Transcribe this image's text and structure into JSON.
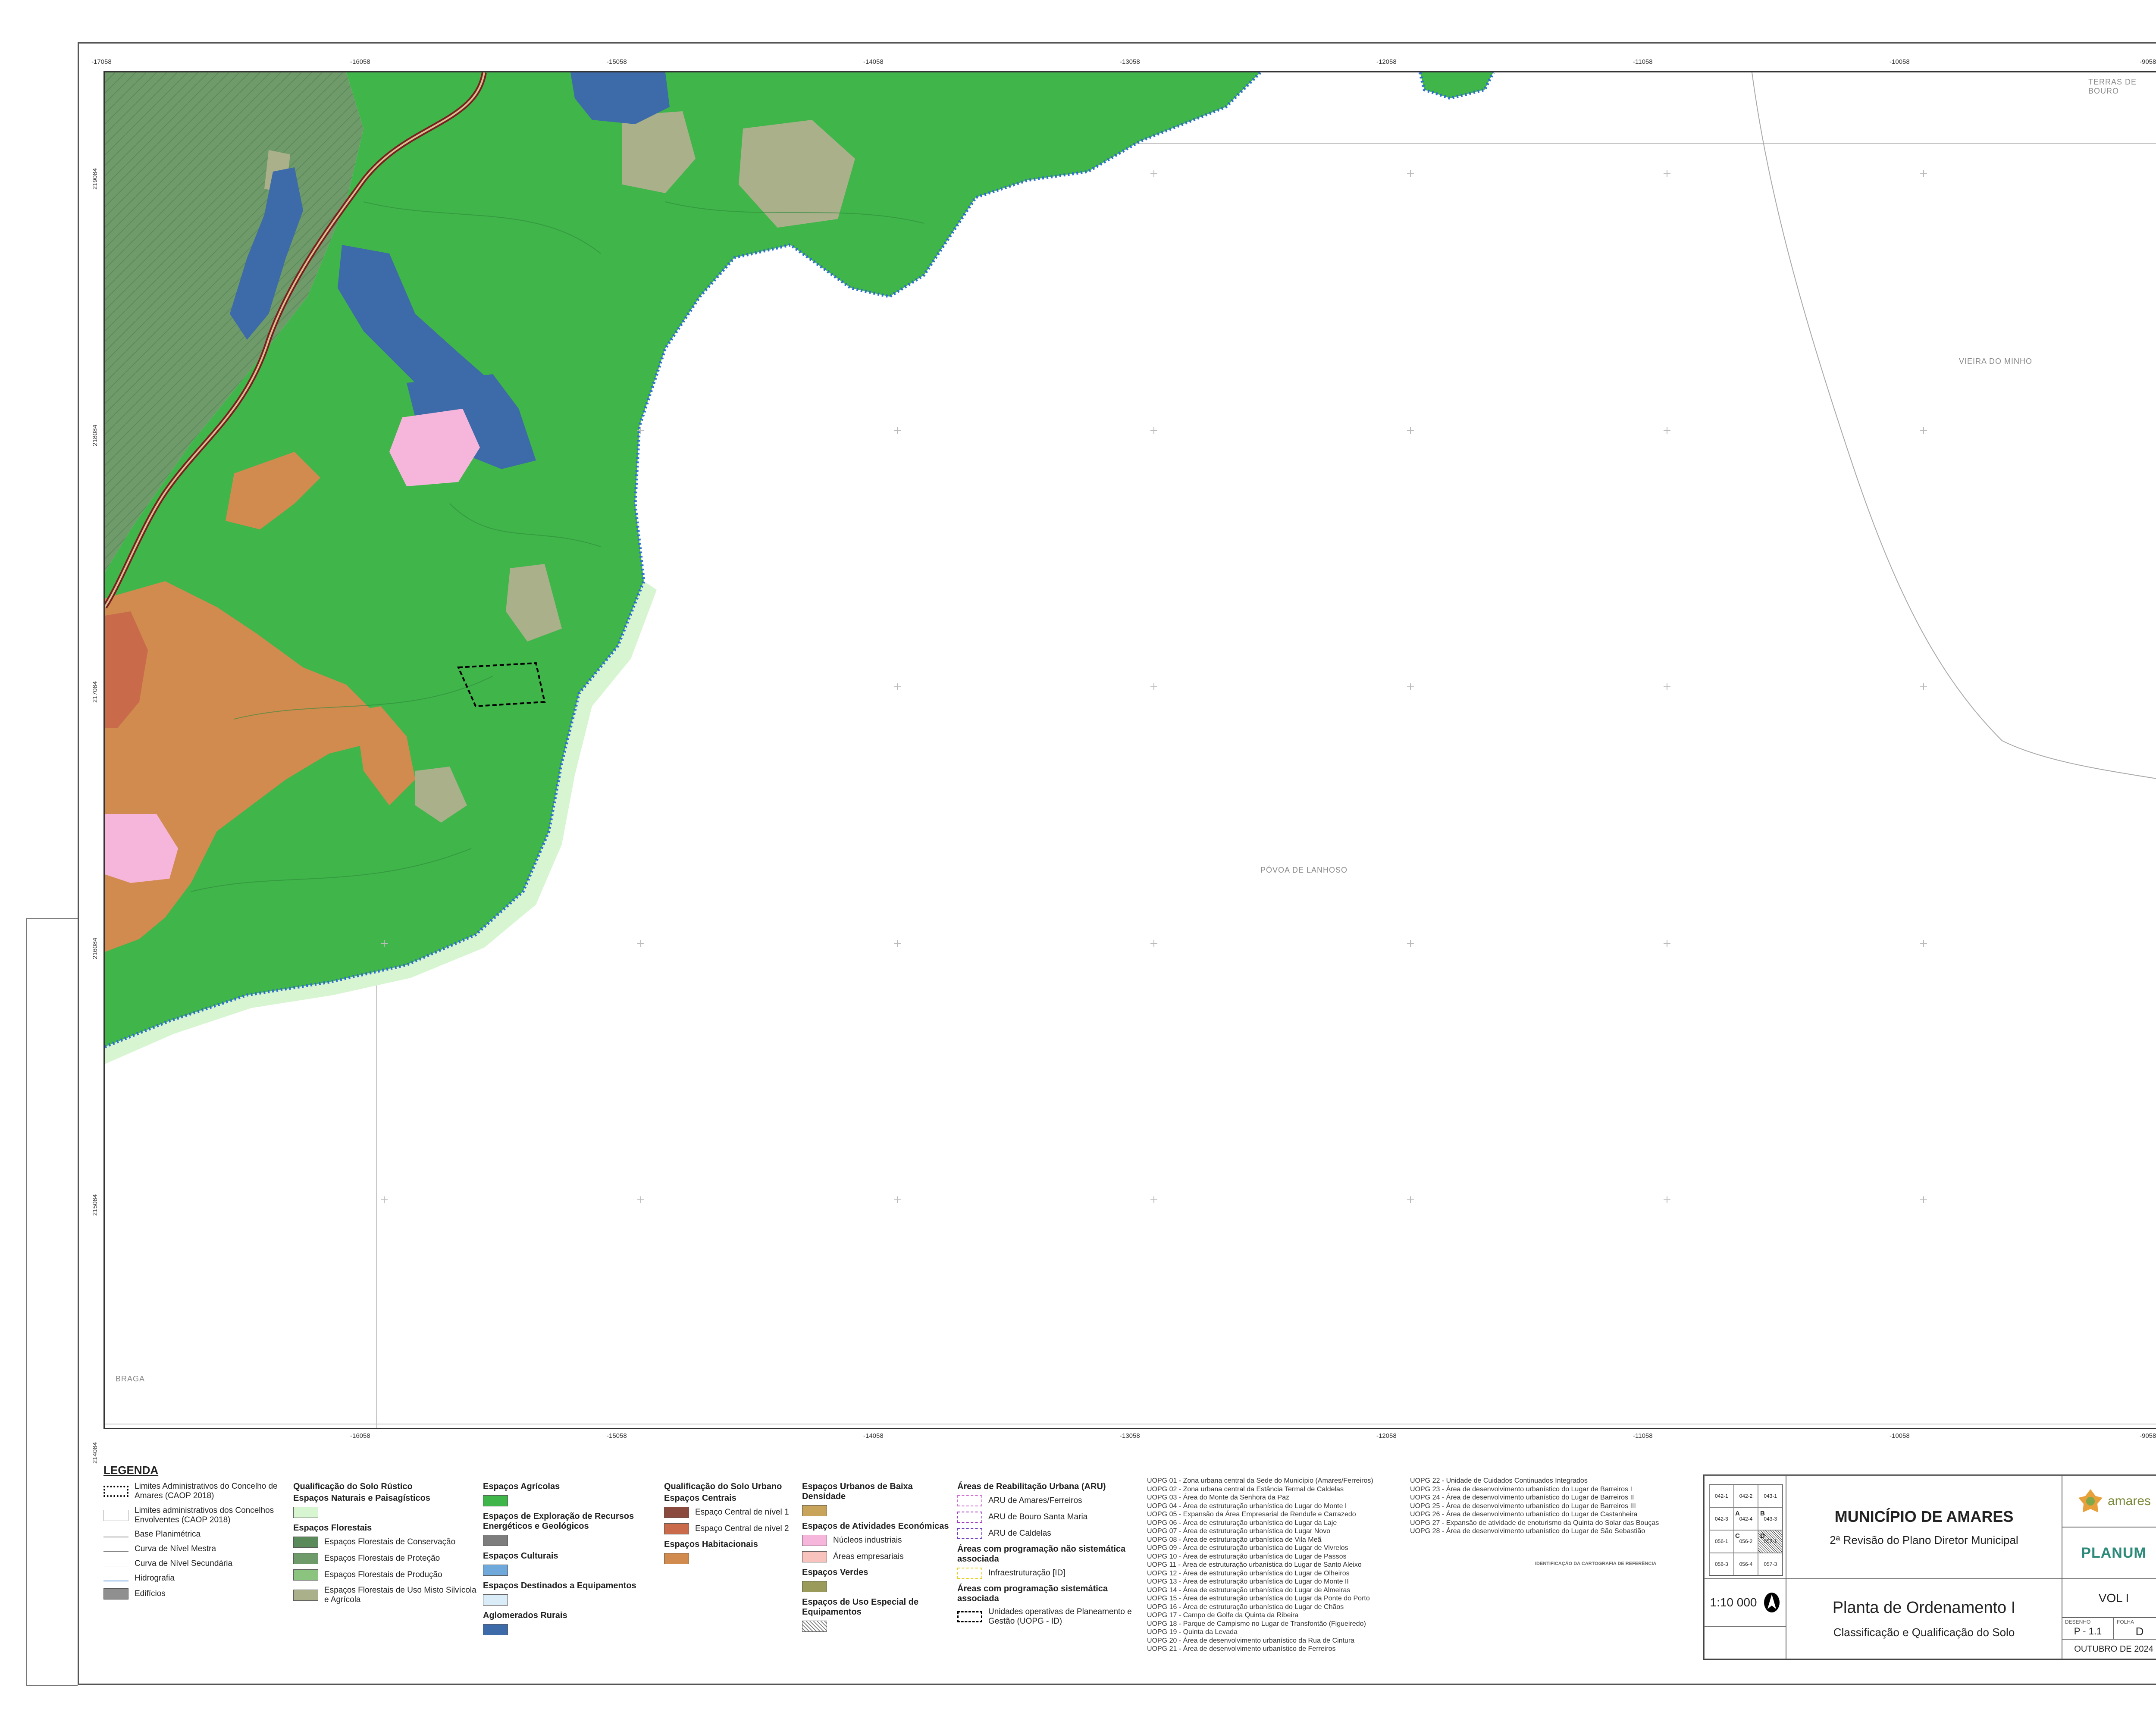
{
  "top_ticks": [
    "-17058",
    "-16058",
    "-15058",
    "-14058",
    "-13058",
    "-12058",
    "-11058",
    "-10058",
    "-9058"
  ],
  "side_ticks": [
    "219084",
    "218084",
    "217084",
    "216084",
    "215084",
    "214084"
  ],
  "place_labels": {
    "terras_bouro": "TERRAS DE BOURO",
    "vieira_minho": "VIEIRA DO MINHO",
    "povoa_lanhoso": "PÓVOA DE LANHOSO",
    "braga": "BRAGA"
  },
  "sheet_labels": {
    "s0564": "056-4",
    "s0573": "057-3"
  },
  "legend": {
    "title": "LEGENDA",
    "admin": [
      {
        "label": "Limites Administrativos do Concelho de Amares (CAOP 2018)",
        "style": "dotted"
      },
      {
        "label": "Limites administrativos dos Concelhos Envolventes (CAOP 2018)",
        "style": "thin"
      },
      {
        "label": "Base Planimétrica",
        "style": "line"
      },
      {
        "label": "Curva de Nível Mestra",
        "style": "line"
      },
      {
        "label": "Curva de Nível Secundária",
        "style": "line"
      },
      {
        "label": "Hidrografia",
        "style": "line"
      },
      {
        "label": "Edifícios",
        "color": "#8f8f8f"
      }
    ],
    "rustico_title": "Qualificação do Solo Rústico",
    "naturais_title": "Espaços Naturais e Paisagísticos",
    "naturais_color": "#d6f5d0",
    "florestais_title": "Espaços Florestais",
    "florestais": [
      {
        "label": "Espaços Florestais de Conservação",
        "color": "#5a8a5a"
      },
      {
        "label": "Espaços Florestais de Proteção",
        "color": "#6f9a6a"
      },
      {
        "label": "Espaços Florestais de Produção",
        "color": "#8ac47e"
      },
      {
        "label": "Espaços Florestais de Uso Misto Silvícola e Agrícola",
        "color": "#a9b08a"
      }
    ],
    "agricolas_title": "Espaços Agrícolas",
    "agricolas_color": "#3fb54a",
    "exploracao_title": "Espaços de Exploração de Recursos Energéticos e Geológicos",
    "exploracao_color": "#7d7d7d",
    "culturais_title": "Espaços Culturais",
    "culturais_color": "#6fa9dc",
    "equip_title": "Espaços Destinados a Equipamentos",
    "equip_color": "#d9ecf7",
    "aglom_title": "Aglomerados Rurais",
    "aglom_color": "#3d6aa8",
    "urbano_title": "Qualificação do Solo Urbano",
    "centrais_title": "Espaços Centrais",
    "centrais": [
      {
        "label": "Espaço Central de nível 1",
        "color": "#8b4a3e"
      },
      {
        "label": "Espaço Central de nível 2",
        "color": "#c96b4b"
      }
    ],
    "habit_title": "Espaços Habitacionais",
    "habit_color": "#d18b4f",
    "baixa_title": "Espaços Urbanos de Baixa Densidade",
    "baixa_color": "#c8a45a",
    "ativ_title": "Espaços de Atividades Económicas",
    "ativ": [
      {
        "label": "Núcleos industriais",
        "color": "#f6b6dc"
      },
      {
        "label": "Áreas empresariais",
        "color": "#f8c3bd"
      }
    ],
    "verdes_title": "Espaços Verdes",
    "verdes_color": "#9a9a5a",
    "especial_title": "Espaços de Uso Especial de Equipamentos",
    "aru_title": "Áreas de Reabilitação Urbana (ARU)",
    "aru": [
      {
        "label": "ARU de Amares/Ferreiros",
        "color": "#d070d0"
      },
      {
        "label": "ARU de Bouro Santa Maria",
        "color": "#a040c0"
      },
      {
        "label": "ARU de Caldelas",
        "color": "#7040c0"
      }
    ],
    "nao_sist_title": "Áreas com programação não sistemática associada",
    "infra_label": "Infraestruturação [ID]",
    "sist_title": "Áreas com programação sistemática associada",
    "uopg_label": "Unidades operativas de Planeamento e Gestão (UOPG - ID)"
  },
  "uopg_left": [
    "UOPG 01 - Zona urbana central da Sede do Município (Amares/Ferreiros)",
    "UOPG 02 - Zona urbana central da Estância Termal de Caldelas",
    "UOPG 03 - Área do Monte da Senhora da Paz",
    "UOPG 04 - Área de estruturação urbanística do Lugar do Monte I",
    "UOPG 05 - Expansão da Área Empresarial de Rendufe e Carrazedo",
    "UOPG 06 - Área de estruturação urbanística do Lugar da Laje",
    "UOPG 07 - Área de estruturação urbanística do Lugar Novo",
    "UOPG 08 - Área de estruturação urbanística de Vila Meã",
    "UOPG 09 - Área de estruturação urbanística do Lugar de Vivrelos",
    "UOPG 10 - Área de estruturação urbanística do Lugar de Passos",
    "UOPG 11 - Área de estruturação urbanística do Lugar de Santo Aleixo",
    "UOPG 12 - Área de estruturação urbanística do Lugar de Olheiros",
    "UOPG 13 - Área de estruturação urbanística do Lugar do Monte II",
    "UOPG 14 - Área de estruturação urbanística do Lugar de Almeiras",
    "UOPG 15 - Área de estruturação urbanística do Lugar da Ponte do Porto",
    "UOPG 16 - Área de estruturação urbanística do Lugar de Chãos",
    "UOPG 17 - Campo de Golfe da Quinta da Ribeira",
    "UOPG 18 - Parque de Campismo no Lugar de Transfontão (Figueiredo)",
    "UOPG 19 - Quinta da Levada",
    "UOPG 20 - Área de desenvolvimento urbanístico da Rua de Cintura",
    "UOPG 21 - Área de desenvolvimento urbanístico de Ferreiros"
  ],
  "uopg_right": [
    "UOPG 22 - Unidade de Cuidados Continuados Integrados",
    "UOPG 23 - Área de desenvolvimento urbanístico do Lugar de Barreiros I",
    "UOPG 24 - Área de desenvolvimento urbanístico do Lugar de Barreiros II",
    "UOPG 25 - Área de desenvolvimento urbanístico do Lugar de Barreiros III",
    "UOPG 26 - Área de desenvolvimento urbanístico do Lugar de Castanheira",
    "UOPG 27 - Expansão de atividade de enoturismo da Quinta do Solar das Bouças",
    "UOPG 28 - Área de desenvolvimento urbanístico do Lugar de São Sebastião"
  ],
  "ident_title": "IDENTIFICAÇÃO DA CARTOGRAFIA DE REFERÊNCIA",
  "title_block": {
    "municipio": "MUNICÍPIO DE AMARES",
    "revisao": "2ª Revisão do Plano Diretor Municipal",
    "planta": "Planta de Ordenamento I",
    "classificacao": "Classificação e Qualificação do Solo",
    "scale": "1:10 000",
    "vol": "VOL I",
    "desenho_lbl": "DESENHO",
    "desenho": "P - 1.1",
    "folha_lbl": "FOLHA",
    "folha": "D",
    "date": "OUTUBRO DE 2024",
    "planum": "PLANUM",
    "amares_logo": "amares",
    "index": [
      "042-1",
      "042-2",
      "043-1",
      "042-3",
      "042-4",
      "043-3",
      "056-1",
      "056-2",
      "057-1",
      "056-3",
      "056-4",
      "057-3"
    ],
    "index_letters": [
      "A",
      "B",
      "C",
      "D"
    ]
  },
  "colors": {
    "agric": "#3fb54a",
    "agric_dark": "#2f9a3a",
    "forest": "#6f9a6a",
    "forest_dark": "#4d7a4f",
    "mixed": "#a9b08a",
    "rural": "#3d6aa8",
    "habit": "#d18b4f",
    "central": "#c96b4b",
    "industrial": "#f6b6dc",
    "road": "#7a1f1f",
    "water": "#2f6fd0",
    "light": "#d6f5d0"
  }
}
